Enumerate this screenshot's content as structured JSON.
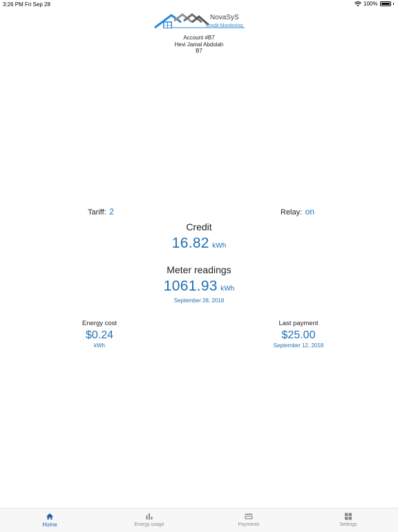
{
  "status_bar": {
    "time": "3:26 PM",
    "date": "Fri Sep 28",
    "battery": "100%"
  },
  "brand": {
    "name": "NovaSyS",
    "tagline": "Credit Monitoring"
  },
  "account": {
    "number": "Account #B7",
    "holder": "Hevi Jamal Abdolah",
    "unit": "B7"
  },
  "tariff": {
    "label": "Tariff:",
    "value": "2"
  },
  "relay": {
    "label": "Relay:",
    "value": "on"
  },
  "credit": {
    "label": "Credit",
    "value": "16.82",
    "unit": "kWh"
  },
  "meter": {
    "label": "Meter readings",
    "value": "1061.93",
    "unit": "kWh",
    "date": "September 28, 2018"
  },
  "energy_cost": {
    "label": "Energy cost",
    "value": "$0.24",
    "unit": "kWh"
  },
  "last_payment": {
    "label": "Last payment",
    "value": "$25.00",
    "date": "September 12, 2018"
  },
  "tabs": [
    {
      "label": "Home",
      "icon": "home-icon",
      "active": true
    },
    {
      "label": "Energy usage",
      "icon": "bar-chart-icon",
      "active": false
    },
    {
      "label": "Payments",
      "icon": "credit-card-icon",
      "active": false
    },
    {
      "label": "Settings",
      "icon": "grid-icon",
      "active": false
    }
  ],
  "colors": {
    "accent": "#1f6fb2",
    "tab_active": "#1f5fa8",
    "tab_inactive": "#8a8a8a"
  }
}
